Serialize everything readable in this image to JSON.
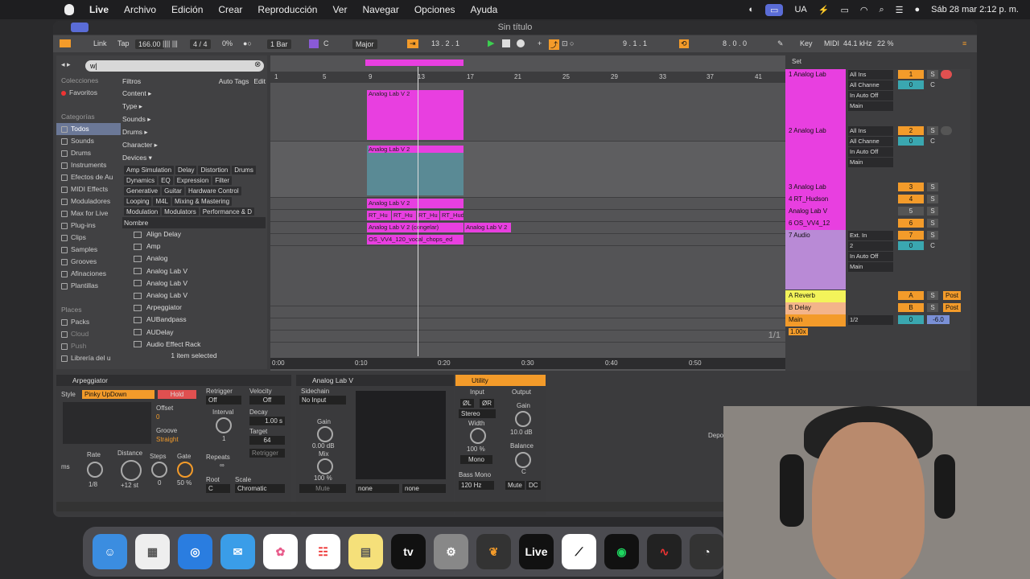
{
  "menubar": {
    "app": "Live",
    "items": [
      "Archivo",
      "Edición",
      "Crear",
      "Reproducción",
      "Ver",
      "Navegar",
      "Opciones",
      "Ayuda"
    ],
    "lang": "UA",
    "datetime": "Sáb 28 mar  2:12 p. m."
  },
  "window": {
    "title": "Sin título"
  },
  "control": {
    "link": "Link",
    "tap": "Tap",
    "bpm": "166.00",
    "sig": "4 / 4",
    "pct": "0%",
    "bar": "1 Bar",
    "key": "C",
    "scale": "Major",
    "pos": "13 .  2 .  1",
    "loop_start": "9 .  1 .  1",
    "loop_len": "8 .  0 .  0",
    "keylbl": "Key",
    "midi": "MIDI",
    "sr": "44.1 kHz",
    "cpu": "22 %"
  },
  "browser": {
    "search": "w|",
    "filters": "Filtros",
    "autotags": "Auto Tags",
    "edit": "Edit",
    "collections_h": "Colecciones",
    "favorites": "Favoritos",
    "categories_h": "Categorías",
    "categories": [
      "Todos",
      "Sounds",
      "Drums",
      "Instruments",
      "Efectos de Au",
      "MIDI Effects",
      "Moduladores",
      "Max for Live",
      "Plug-ins",
      "Clips",
      "Samples",
      "Grooves",
      "Afinaciones",
      "Plantillas"
    ],
    "places_h": "Places",
    "places": [
      "Packs",
      "Cloud",
      "Push",
      "Librería del u"
    ],
    "facets": [
      "Content ▸",
      "Type ▸",
      "Sounds ▸",
      "Drums ▸",
      "Character ▸",
      "Devices ▾"
    ],
    "tags": [
      "Amp Simulation",
      "Delay",
      "Distortion",
      "Drums",
      "Dynamics",
      "EQ",
      "Expression",
      "Filter",
      "Generative",
      "Guitar",
      "Hardware Control",
      "Looping",
      "M4L",
      "Mixing & Mastering",
      "Modulation",
      "Modulators",
      "Performance & D"
    ],
    "name_h": "Nombre",
    "files": [
      "Align Delay",
      "Amp",
      "Analog",
      "Analog Lab V",
      "Analog Lab V",
      "Analog Lab V",
      "Arpeggiator",
      "AUBandpass",
      "AUDelay",
      "Audio Effect Rack"
    ],
    "status": "1 item selected"
  },
  "ruler": [
    "1",
    "5",
    "9",
    "13",
    "17",
    "21",
    "25",
    "29",
    "33",
    "37",
    "41"
  ],
  "timebar": [
    "0:00",
    "0:10",
    "0:20",
    "0:30",
    "0:40",
    "0:50"
  ],
  "clips": {
    "c1": "Analog Lab V 2",
    "c2": "Analog Lab V 2",
    "c3": "Analog Lab V 2",
    "c4a": "RT_Hu",
    "c4b": "RT_Hu",
    "c4c": "RT_Hu",
    "c4d": "RT_Hud",
    "c5": "Analog Lab V 2 (congelar)",
    "c5b": "Analog Lab V 2",
    "c6": "OS_VV4_120_vocal_chops_ed"
  },
  "mixer": {
    "set": "Set",
    "tracks": [
      {
        "name": "1 Analog Lab",
        "in": "All Ins",
        "ch": "All Channe",
        "mon": "In  Auto  Off",
        "out": "Main",
        "num": "1",
        "vol": "0",
        "pan": "C",
        "color": "#e83fe0"
      },
      {
        "name": "2 Analog Lab",
        "in": "All Ins",
        "ch": "All Channe",
        "mon": "In  Auto  Off",
        "out": "Main",
        "num": "2",
        "vol": "0",
        "pan": "C",
        "color": "#e83fe0"
      },
      {
        "name": "3 Analog Lab",
        "num": "3",
        "color": "#e83fe0"
      },
      {
        "name": "4 RT_Hudson",
        "num": "4",
        "color": "#e83fe0"
      },
      {
        "name": "Analog Lab V",
        "num": "5",
        "color": "#e83fe0"
      },
      {
        "name": "6 OS_VV4_12",
        "num": "6",
        "color": "#e83fe0"
      },
      {
        "name": "7 Audio",
        "in": "Ext. In",
        "ch": "2",
        "mon": "In  Auto  Off",
        "out": "Main",
        "num": "7",
        "vol": "0",
        "pan": "C",
        "color": "#b98ad6"
      }
    ],
    "returnA": "A Reverb",
    "returnB": "B Delay",
    "main": "Main",
    "mainsel": "1/2",
    "mainvol": "-6.0",
    "post": "Post",
    "pageinfo": "1/1",
    "zoom": "1.00x"
  },
  "devices": {
    "arp": {
      "title": "Arpeggiator",
      "style_l": "Style",
      "style": "Pinky UpDown",
      "hold": "Hold",
      "offset": "Offset",
      "offset_v": "0",
      "groove": "Groove",
      "groove_v": "Straight",
      "retrig": "Retrigger",
      "retrig_v": "Off",
      "interval": "Interval",
      "interval_v": "1",
      "repeats": "Repeats",
      "repeats_v": "∞",
      "velocity": "Velocity",
      "velocity_v": "Off",
      "decay": "Decay",
      "decay_v": "1.00 s",
      "target": "Target",
      "target_v": "64",
      "retrigger_btn": "Retrigger",
      "rate": "Rate",
      "rate_v": "1/8",
      "distance": "Distance",
      "distance_v": "+12 st",
      "steps": "Steps",
      "steps_v": "0",
      "gate": "Gate",
      "gate_v": "50 %",
      "root": "Root",
      "root_v": "C",
      "scale": "Scale",
      "scale_v": "Chromatic",
      "ms": "ms"
    },
    "alv": {
      "title": "Analog Lab V",
      "sidechain": "Sidechain",
      "sc_v": "No Input",
      "gain": "Gain",
      "gain_v": "0.00 dB",
      "mix": "Mix",
      "mix_v": "100 %",
      "mute": "Mute",
      "none1": "none",
      "none2": "none"
    },
    "util": {
      "title": "Utility",
      "input": "Input",
      "output": "Output",
      "phl": "ØL",
      "phr": "ØR",
      "stereo": "Stereo",
      "width": "Width",
      "width_v": "100 %",
      "mono": "Mono",
      "bass": "Bass Mono",
      "bass_v": "120 Hz",
      "gain": "Gain",
      "gain_v": "10.0 dB",
      "balance": "Balance",
      "balance_v": "C",
      "mute": "Mute",
      "dc": "DC"
    }
  },
  "drop": "Depo",
  "dock": [
    "Finder",
    "Launchpad",
    "Safari",
    "Mail",
    "Fotos",
    "Recordatorios",
    "Notas",
    "TV",
    "Ajustes",
    "FL",
    "Live",
    "Cap",
    "Spotify",
    "Audio",
    "OBS"
  ]
}
